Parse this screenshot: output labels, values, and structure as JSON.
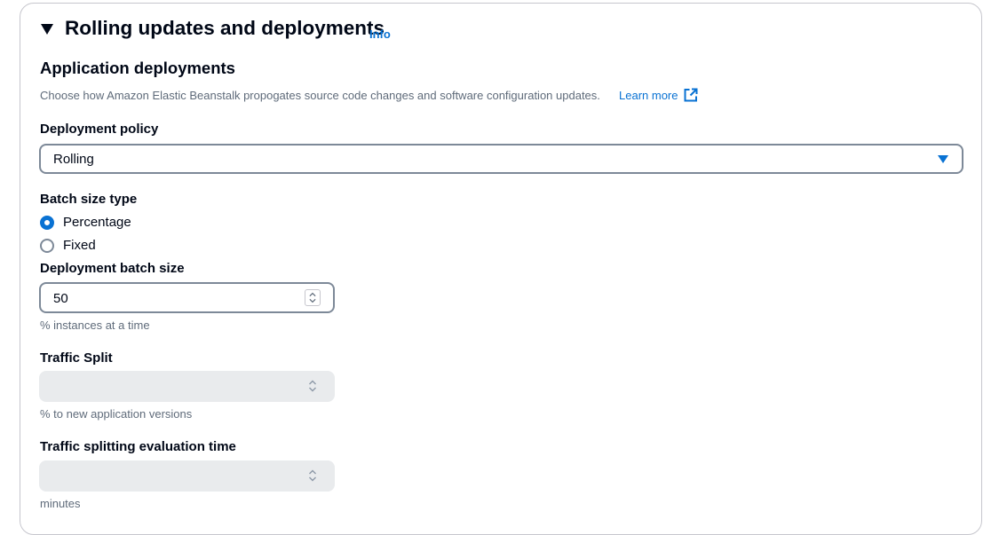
{
  "section": {
    "title": "Rolling updates and deployments",
    "info_link": "Info"
  },
  "app_deployments": {
    "heading": "Application deployments",
    "description": "Choose how Amazon Elastic Beanstalk propogates source code changes and software configuration updates.",
    "learn_more": "Learn more"
  },
  "deployment_policy": {
    "label": "Deployment policy",
    "value": "Rolling"
  },
  "batch_size_type": {
    "label": "Batch size type",
    "options": [
      {
        "label": "Percentage",
        "selected": true
      },
      {
        "label": "Fixed",
        "selected": false
      }
    ]
  },
  "deployment_batch_size": {
    "label": "Deployment batch size",
    "value": "50",
    "hint": "% instances at a time"
  },
  "traffic_split": {
    "label": "Traffic Split",
    "value": "",
    "hint": "% to new application versions"
  },
  "traffic_eval_time": {
    "label": "Traffic splitting evaluation time",
    "value": "",
    "hint": "minutes"
  },
  "colors": {
    "link": "#0972d3",
    "text": "#000716",
    "secondary_text": "#5f6b7a",
    "border": "#7d8998",
    "disabled_bg": "#e9ebed"
  }
}
